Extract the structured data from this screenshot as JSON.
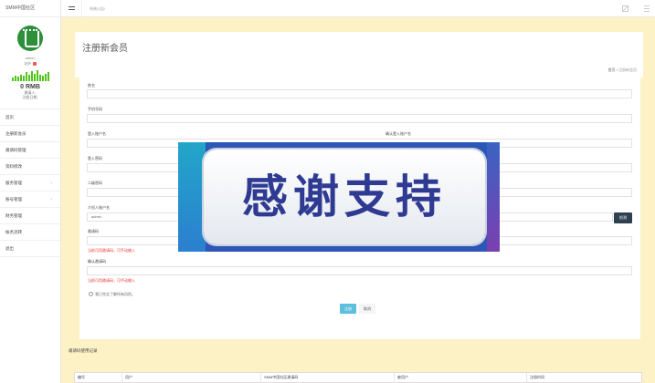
{
  "app": {
    "brand": "SMM中国社区"
  },
  "profile": {
    "username": "admin",
    "status_label": "站外",
    "balance": "0 RMB",
    "meta_line1": "邀请人:",
    "meta_line2": "注册日期:",
    "activity": [
      0.3,
      0.5,
      0.4,
      0.6,
      0.5,
      0.8,
      0.6,
      0.9,
      0.7,
      1.0,
      0.6,
      0.5,
      0.7,
      0.8
    ]
  },
  "sidebar": {
    "items": [
      {
        "label": "首页",
        "has_children": false
      },
      {
        "label": "注册新会员",
        "has_children": false
      },
      {
        "label": "邀请码管理",
        "has_children": false
      },
      {
        "label": "资料修改",
        "has_children": false
      },
      {
        "label": "服务管理",
        "has_children": true
      },
      {
        "label": "账号管理",
        "has_children": true
      },
      {
        "label": "财务管理",
        "has_children": false
      },
      {
        "label": "帐务流转",
        "has_children": false
      },
      {
        "label": "退出",
        "has_children": false
      }
    ]
  },
  "topbar": {
    "notice": "系统公告!"
  },
  "page": {
    "title": "注册新会员",
    "breadcrumb": {
      "home": "首页",
      "sep": "/",
      "current": "注册新会员"
    }
  },
  "form": {
    "name_label": "姓名",
    "phone_label": "手机号码",
    "login_label": "登入账户名",
    "confirm_login_label": "确认登入账户名",
    "password_label": "登入密码",
    "password2_label": "二级密码",
    "referrer_label": "介绍人账户名",
    "referrer_value": "admin",
    "verify_button": "检测",
    "invite_label": "邀请码",
    "invite_hint": "当前可用邀请码，可手动输入",
    "confirm_invite_label": "确认邀请码",
    "confirm_invite_hint": "当前可用邀请码，可手动输入",
    "agree_text": "我已完全了解所有风险。",
    "submit_label": "注册",
    "cancel_label": "取消"
  },
  "overlay": {
    "text": "感谢支持"
  },
  "records": {
    "title": "邀请码使用记录",
    "columns": [
      "编号",
      "用户",
      "SMM中国社区邀请码",
      "被用户",
      "注册时间"
    ]
  }
}
